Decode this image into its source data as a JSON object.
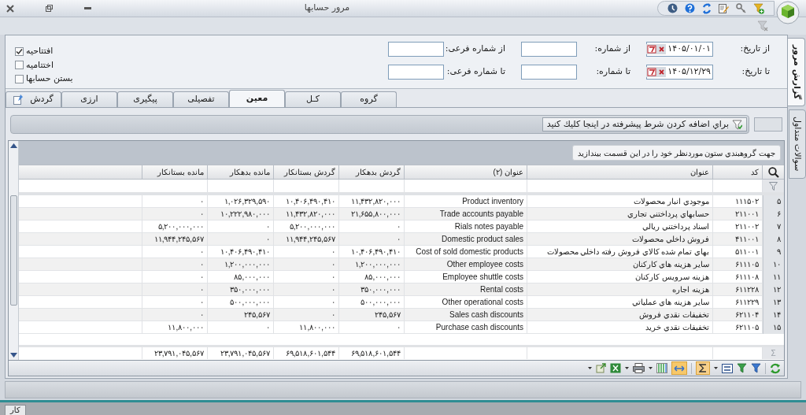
{
  "window": {
    "title": "مرور حسابها"
  },
  "side_tabs": [
    {
      "label": "گزارش مرور",
      "selected": true
    },
    {
      "label": "سوالات متداول",
      "selected": false
    }
  ],
  "filters": [
    {
      "date_label": "از تاریخ:",
      "date": "۱۴۰۵/۰۱/۰۱",
      "number_label": "از شماره:",
      "sub_number_label": "از شماره فرعی:"
    },
    {
      "date_label": "تا تاریخ:",
      "date": "۱۴۰۵/۱۲/۲۹",
      "number_label": "تا شماره:",
      "sub_number_label": "تا شماره فرعی:"
    }
  ],
  "options": [
    {
      "label": "افتتاحیه",
      "checked": true
    },
    {
      "label": "اختتامیه",
      "checked": false
    },
    {
      "label": "بستن حسابها",
      "checked": false
    }
  ],
  "tabs": [
    {
      "label": "گروه",
      "selected": false
    },
    {
      "label": "کـل",
      "selected": false
    },
    {
      "label": "معین",
      "selected": true
    },
    {
      "label": "تفصیلی",
      "selected": false
    },
    {
      "label": "پیگیری",
      "selected": false
    },
    {
      "label": "ارزی",
      "selected": false
    },
    {
      "label": "گردش",
      "selected": false
    }
  ],
  "advanced_filter": "براي اضافه كردن شرط پيشرفته در اينجا كليك كنيد",
  "group_hint": "جهت گروهبندي ستون موردنظر خود را در اين قسمت بيندازيد",
  "table": {
    "columns": [
      "کد",
      "عنوان",
      "عنوان (۲)",
      "گردش بدهکار",
      "گردش بستانکار",
      "مانده بدهکار",
      "مانده بستانکار"
    ],
    "rows": [
      {
        "number": "۵",
        "cells": [
          "۱۱۱۵۰۲",
          "موجودي انبار محصولات",
          "Product inventory",
          "۱۱,۴۳۲,۸۲۰,۰۰۰",
          "۱۰,۴۰۶,۴۹۰,۴۱۰",
          "۱,۰۲۶,۳۲۹,۵۹۰",
          "۰"
        ]
      },
      {
        "number": "۶",
        "cells": [
          "۲۱۱۰۰۱",
          "حسابهاي پرداختني تجاري",
          "Trade accounts payable",
          "۲۱,۶۵۵,۸۰۰,۰۰۰",
          "۱۱,۴۳۲,۸۲۰,۰۰۰",
          "۱۰,۲۲۲,۹۸۰,۰۰۰",
          "۰"
        ]
      },
      {
        "number": "۷",
        "cells": [
          "۲۱۱۰۰۲",
          "اسناد پرداختني ريالي",
          "Rials notes payable",
          "۰",
          "۵,۲۰۰,۰۰۰,۰۰۰",
          "۰",
          "۵,۲۰۰,۰۰۰,۰۰۰"
        ]
      },
      {
        "number": "۸",
        "cells": [
          "۴۱۱۰۰۱",
          "فروش داخلي محصولات",
          "Domestic product sales",
          "۰",
          "۱۱,۹۴۴,۲۴۵,۵۶۷",
          "۰",
          "۱۱,۹۴۴,۲۴۵,۵۶۷"
        ]
      },
      {
        "number": "۹",
        "cells": [
          "۵۱۱۰۰۱",
          "بهاي تمام شده كالاي فروش رفته داخلي محصولات",
          "Cost of sold domestic products",
          "۱۰,۴۰۶,۴۹۰,۴۱۰",
          "۰",
          "۱۰,۴۰۶,۴۹۰,۴۱۰",
          "۰"
        ]
      },
      {
        "number": "۱۰",
        "cells": [
          "۶۱۱۱۰۵",
          "ساير هزينه هاي كاركنان",
          "Other employee costs",
          "۱,۲۰۰,۰۰۰,۰۰۰",
          "۰",
          "۱,۲۰۰,۰۰۰,۰۰۰",
          "۰"
        ]
      },
      {
        "number": "۱۱",
        "cells": [
          "۶۱۱۱۰۸",
          "هزينه سرويس كاركنان",
          "Employee shuttle costs",
          "۸۵,۰۰۰,۰۰۰",
          "۰",
          "۸۵,۰۰۰,۰۰۰",
          "۰"
        ]
      },
      {
        "number": "۱۲",
        "cells": [
          "۶۱۱۲۲۸",
          "هزينه اجاره",
          "Rental costs",
          "۳۵۰,۰۰۰,۰۰۰",
          "۰",
          "۳۵۰,۰۰۰,۰۰۰",
          "۰"
        ]
      },
      {
        "number": "۱۳",
        "cells": [
          "۶۱۱۲۲۹",
          "ساير هزينه هاي عملياتي",
          "Other operational costs",
          "۵۰۰,۰۰۰,۰۰۰",
          "۰",
          "۵۰۰,۰۰۰,۰۰۰",
          "۰"
        ]
      },
      {
        "number": "۱۴",
        "cells": [
          "۶۲۱۱۰۴",
          "تخفيفات نقدي فروش",
          "Sales cash discounts",
          "۲۴۵,۵۶۷",
          "۰",
          "۲۴۵,۵۶۷",
          "۰"
        ]
      },
      {
        "number": "۱۵",
        "cells": [
          "۶۲۱۱۰۵",
          "تخفيفات نقدي خريد",
          "Purchase cash discounts",
          "۰",
          "۱۱,۸۰۰,۰۰۰",
          "۰",
          "۱۱,۸۰۰,۰۰۰"
        ]
      }
    ],
    "totals_marker": "Σ",
    "totals": [
      "۶۹,۵۱۸,۶۰۱,۵۴۴",
      "۶۹,۵۱۸,۶۰۱,۵۴۴",
      "۲۳,۷۹۱,۰۴۵,۵۶۷",
      "۲۳,۷۹۱,۰۴۵,۵۶۷"
    ]
  },
  "taskbar": {
    "tab": "کار"
  }
}
